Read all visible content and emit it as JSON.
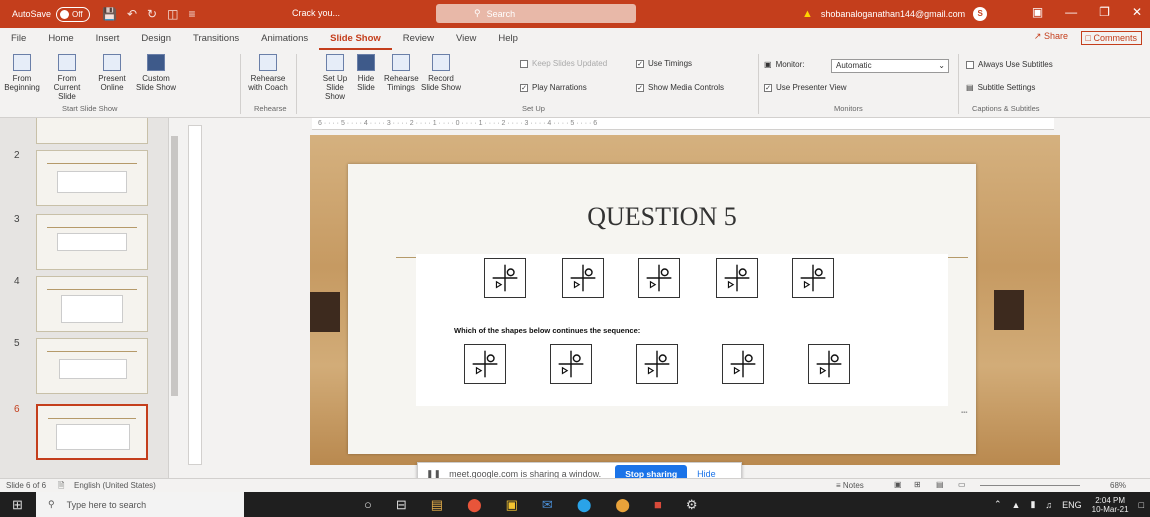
{
  "titlebar": {
    "autosave_label": "AutoSave",
    "autosave_state": "Off",
    "document_title": "Crack you...",
    "search_placeholder": "Search",
    "account_email": "shobanaloganathan144@gmail.com",
    "account_initial": "S"
  },
  "menu": {
    "tabs": [
      "File",
      "Home",
      "Insert",
      "Design",
      "Transitions",
      "Animations",
      "Slide Show",
      "Review",
      "View",
      "Help"
    ],
    "active_tab": "Slide Show",
    "share_label": "Share",
    "comments_label": "Comments"
  },
  "ribbon": {
    "from_beginning": "From Beginning",
    "from_current": "From Current Slide",
    "present_online": "Present Online",
    "custom_show": "Custom Slide Show",
    "start_group": "Start Slide Show",
    "rehearse_coach": "Rehearse with Coach",
    "rehearse_group": "Rehearse",
    "setup_show": "Set Up Slide Show",
    "hide_slide": "Hide Slide",
    "rehearse_timings": "Rehearse Timings",
    "record_show": "Record Slide Show",
    "keep_updated": "Keep Slides Updated",
    "use_timings": "Use Timings",
    "play_narrations": "Play Narrations",
    "show_media": "Show Media Controls",
    "setup_group": "Set Up",
    "monitor_label": "Monitor:",
    "monitor_value": "Automatic",
    "presenter_view": "Use Presenter View",
    "monitors_group": "Monitors",
    "always_subtitles": "Always Use Subtitles",
    "subtitle_settings": "Subtitle Settings",
    "captions_group": "Captions & Subtitles"
  },
  "thumbnails": {
    "numbers": [
      "2",
      "3",
      "4",
      "5",
      "6"
    ],
    "selected": "6"
  },
  "slide": {
    "title": "QUESTION 5",
    "question": "Which of the shapes below continues the sequence:"
  },
  "ruler_text": "6 · · · · 5 · · · · 4 · · · · 3 · · · · 2 · · · · 1 · · · · 0 · · · · 1 · · · · 2 · · · · 3 · · · · 4 · · · · 5 · · · · 6",
  "sharebar": {
    "message": "meet.google.com is sharing a window.",
    "stop_label": "Stop sharing",
    "hide_label": "Hide"
  },
  "statusbar": {
    "slide_info": "Slide 6 of 6",
    "language": "English (United States)",
    "notes_label": "Notes",
    "zoom": "68%"
  },
  "taskbar": {
    "search_placeholder": "Type here to search",
    "language": "ENG",
    "time": "2:04 PM",
    "date": "10-Mar-21"
  }
}
